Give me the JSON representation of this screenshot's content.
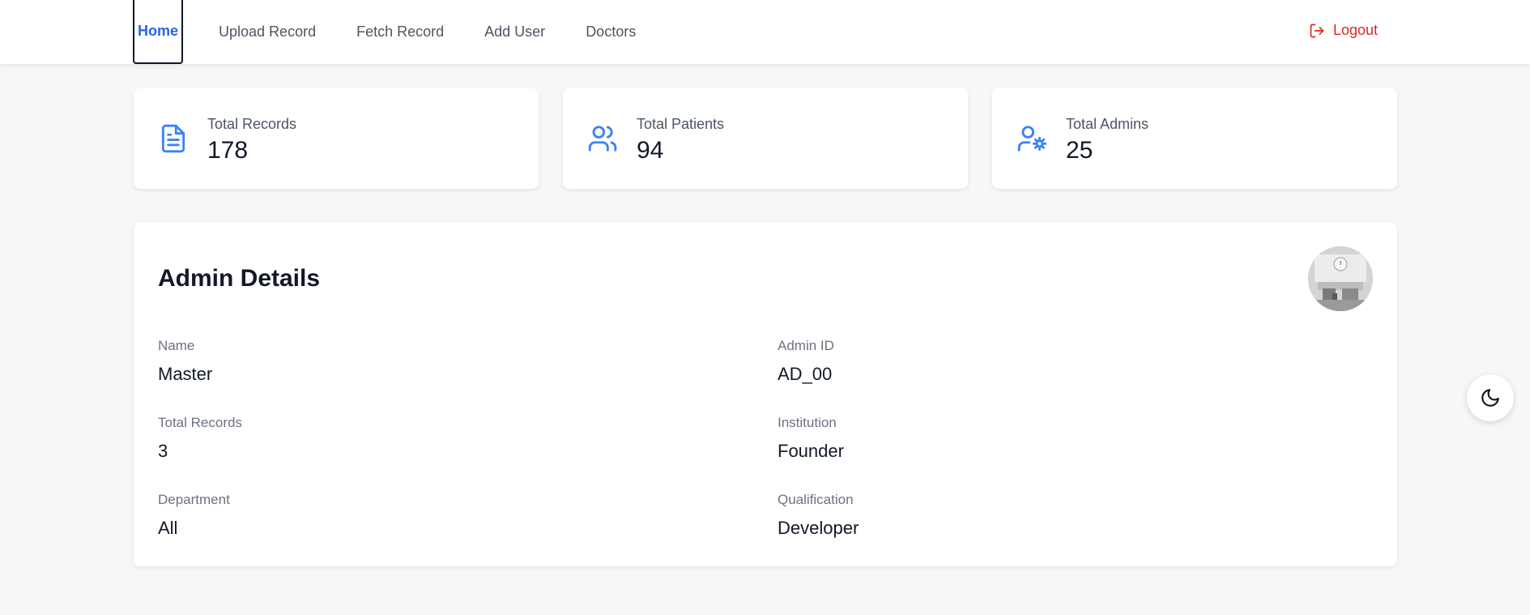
{
  "nav": {
    "items": [
      {
        "label": "Home",
        "active": true
      },
      {
        "label": "Upload Record"
      },
      {
        "label": "Fetch Record"
      },
      {
        "label": "Add User"
      },
      {
        "label": "Doctors"
      }
    ],
    "logout_label": "Logout"
  },
  "stats": [
    {
      "label": "Total Records",
      "value": "178",
      "icon": "document-icon"
    },
    {
      "label": "Total Patients",
      "value": "94",
      "icon": "users-icon"
    },
    {
      "label": "Total Admins",
      "value": "25",
      "icon": "user-cog-icon"
    }
  ],
  "details": {
    "title": "Admin Details",
    "fields": [
      {
        "label": "Name",
        "value": "Master"
      },
      {
        "label": "Admin ID",
        "value": "AD_00"
      },
      {
        "label": "Total Records",
        "value": "3"
      },
      {
        "label": "Institution",
        "value": "Founder"
      },
      {
        "label": "Department",
        "value": "All"
      },
      {
        "label": "Qualification",
        "value": "Developer"
      }
    ]
  },
  "colors": {
    "accent": "#2563eb",
    "icon_blue": "#3b82f6",
    "logout_red": "#dc2626",
    "background": "#f6f7f9"
  }
}
